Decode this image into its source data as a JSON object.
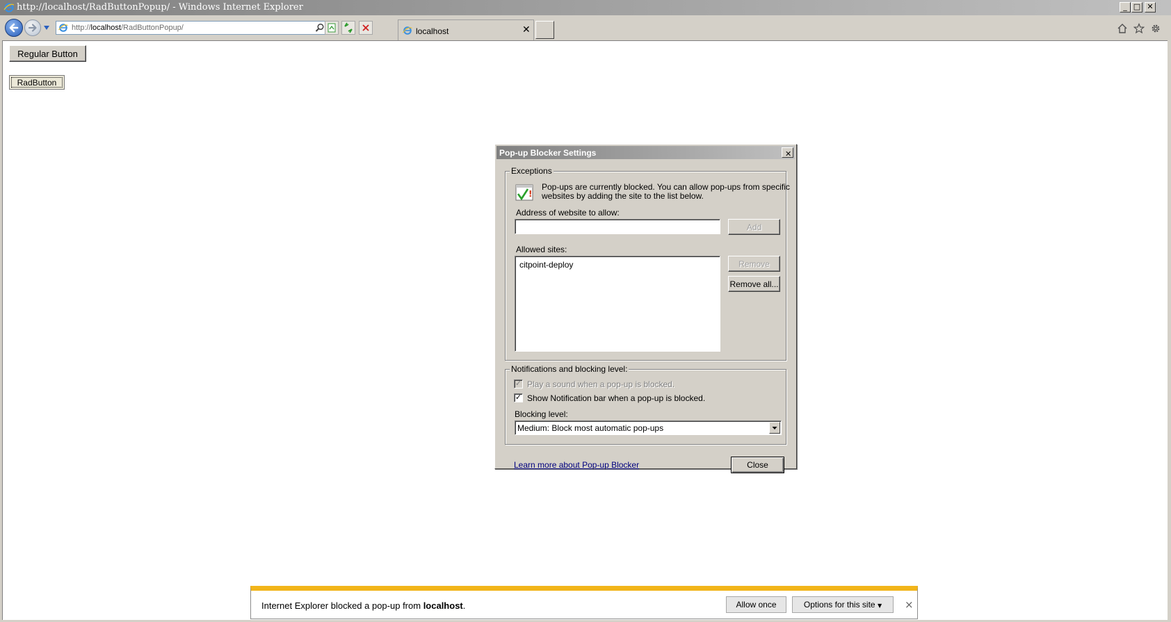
{
  "window": {
    "title": "http://localhost/RadButtonPopup/ - Windows Internet Explorer",
    "minimize_glyph": "_",
    "maximize_glyph": "□",
    "close_glyph": "✕"
  },
  "address_bar": {
    "prefix": "http://",
    "host": "localhost",
    "path": "/RadButtonPopup/"
  },
  "tab": {
    "label": "localhost",
    "close_glyph": "✕"
  },
  "page": {
    "regular_button_label": "Regular Button",
    "rad_button_label": "RadButton"
  },
  "dialog": {
    "title": "Pop-up Blocker Settings",
    "close_glyph": "✕",
    "exceptions": {
      "legend": "Exceptions",
      "info_line1": "Pop-ups are currently blocked.  You can allow pop-ups from specific",
      "info_line2": "websites by adding the site to the list below.",
      "address_label": "Address of website to allow:",
      "address_value": "",
      "add_label": "Add",
      "allowed_label": "Allowed sites:",
      "allowed_sites": [
        "citpoint-deploy"
      ],
      "remove_label": "Remove",
      "remove_all_label": "Remove all..."
    },
    "notifications": {
      "legend": "Notifications and blocking level:",
      "play_sound_label": "Play a sound when a pop-up is blocked.",
      "play_sound_checked": true,
      "show_bar_label": "Show Notification bar when a pop-up is blocked.",
      "show_bar_checked": true,
      "blocking_label": "Blocking level:",
      "blocking_value": "Medium: Block most automatic pop-ups"
    },
    "learn_more": "Learn more about Pop-up Blocker",
    "close_label": "Close"
  },
  "notification_bar": {
    "message_prefix": "Internet Explorer blocked a pop-up from ",
    "message_site": "localhost",
    "message_suffix": ".",
    "allow_once_label": "Allow once",
    "options_label": "Options for this site",
    "options_arrow": "▼",
    "close_glyph": "×"
  },
  "colors": {
    "notification_accent": "#f2b51a",
    "chrome_gray": "#d4d0c8",
    "link": "#00007f"
  },
  "icons": [
    "ie-logo-icon",
    "back-arrow-icon",
    "forward-arrow-icon",
    "search-icon",
    "compatibility-icon",
    "refresh-icon",
    "stop-icon",
    "home-icon",
    "favorites-star-icon",
    "tools-gear-icon",
    "popup-blocked-icon"
  ]
}
